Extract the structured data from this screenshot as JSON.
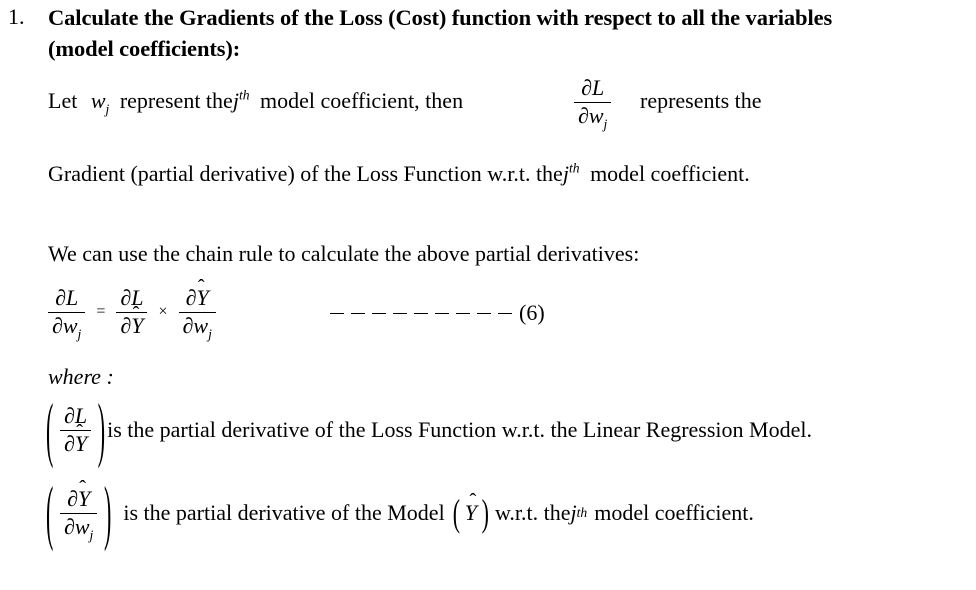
{
  "document": {
    "background_color": "#ffffff",
    "text_color": "#000000"
  },
  "list_item": {
    "marker": "1.",
    "heading_line_1": "Calculate the Gradients of the Loss (Cost) function with respect to all the variables",
    "heading_line_2": "(model coefficients):"
  },
  "paragraph_1": {
    "before_fraction": "Let",
    "variable": "w",
    "variable_subscript": "j",
    "mid_text_a": "represent the",
    "ordinal_base": "j",
    "ordinal_suffix": "th",
    "mid_text_b": "model coefficient, then",
    "fraction": {
      "numerator": "∂L",
      "denominator_base": "∂w",
      "denominator_sub": "j"
    },
    "after_fraction": "represents the"
  },
  "paragraph_2": {
    "text_a": "Gradient (partial derivative) of the Loss Function w.r.t. the",
    "ordinal_base": "j",
    "ordinal_suffix": "th",
    "text_b": "model coefficient."
  },
  "paragraph_3": {
    "text": "We can use the chain rule to calculate the above partial derivatives:"
  },
  "equation_6": {
    "lhs": {
      "numerator": "∂L",
      "denominator_base": "∂w",
      "denominator_sub": "j"
    },
    "equals": "=",
    "term_1": {
      "numerator": "∂L",
      "denominator_base": "∂Y",
      "denominator_hat": "ˆ"
    },
    "times": "×",
    "term_2": {
      "numerator_base": "∂Y",
      "numerator_hat": "ˆ",
      "denominator_base": "∂w",
      "denominator_sub": "j"
    },
    "dash_count": 9,
    "tag": "(6)"
  },
  "where_label": "where :",
  "where_items": [
    {
      "fraction": {
        "numerator": "∂L",
        "denominator_base": "∂Y",
        "denominator_hat": "ˆ"
      },
      "description": "is the partial derivative of the Loss Function w.r.t. the Linear Regression Model."
    },
    {
      "fraction": {
        "numerator_base": "∂Y",
        "numerator_hat": "ˆ",
        "denominator_base": "∂w",
        "denominator_sub": "j"
      },
      "description_a": "is the partial derivative of the Model",
      "model_symbol_base": "Y",
      "model_symbol_hat": "ˆ",
      "description_b": "w.r.t. the",
      "ordinal_base": "j",
      "ordinal_suffix": "th",
      "description_c": "model coefficient."
    }
  ]
}
